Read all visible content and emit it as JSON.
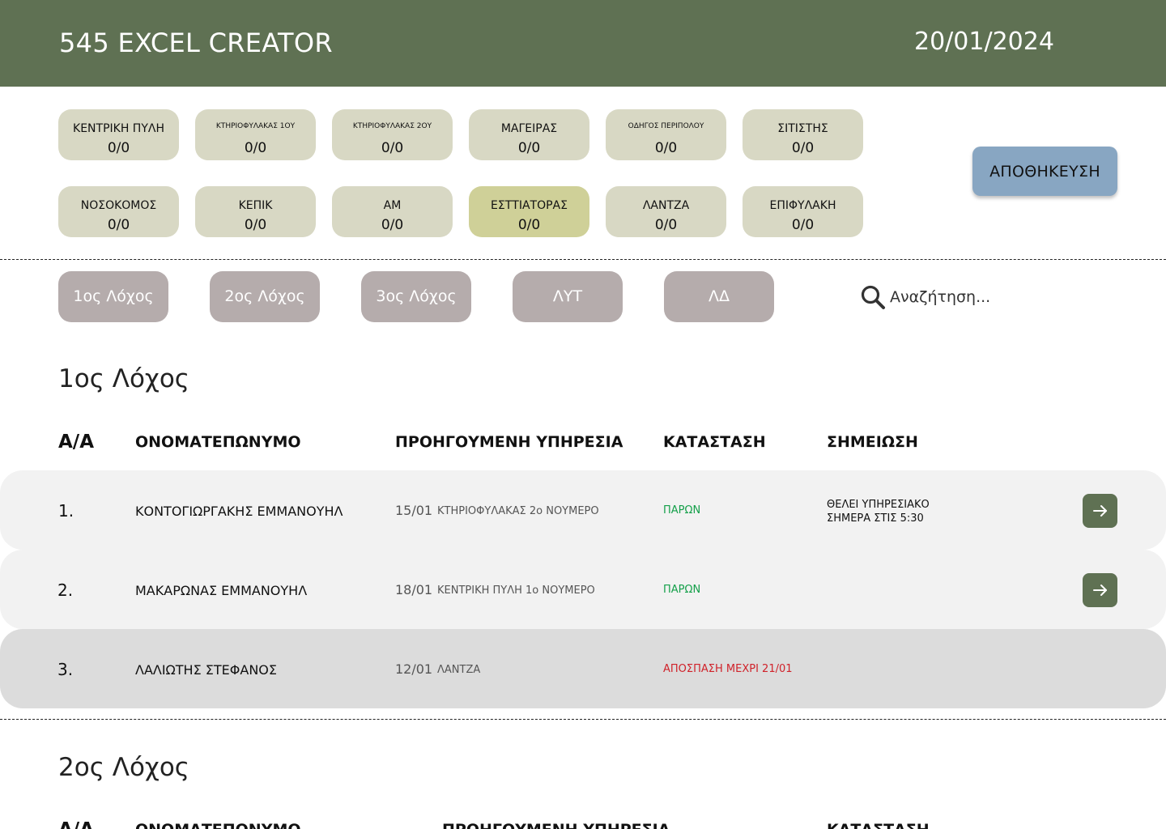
{
  "header": {
    "title": "545 EXCEL CREATOR",
    "date": "20/01/2024"
  },
  "posts": [
    {
      "name": "ΚΕΝΤΡΙΚΗ ΠΥΛΗ",
      "count": "0/0"
    },
    {
      "name": "ΚΤΗΡΙΟΦΥΛΑΚΑΣ 1ΟΥ",
      "count": "0/0"
    },
    {
      "name": "ΚΤΗΡΙΟΦΥΛΑΚΑΣ 2ΟΥ",
      "count": "0/0"
    },
    {
      "name": "ΜΑΓΕΙΡΑΣ",
      "count": "0/0"
    },
    {
      "name": "ΟΔΗΓΟΣ ΠΕΡΙΠΟΛΟΥ",
      "count": "0/0"
    },
    {
      "name": "ΣΙΤΙΣΤΗΣ",
      "count": "0/0"
    },
    {
      "name": "ΝΟΣΟΚΟΜΟΣ",
      "count": "0/0"
    },
    {
      "name": "ΚΕΠΙΚ",
      "count": "0/0"
    },
    {
      "name": "ΑΜ",
      "count": "0/0"
    },
    {
      "name": "ΕΣΤΤΙΑΤΟΡΑΣ",
      "count": "0/0"
    },
    {
      "name": "ΛΑΝΤΖΑ",
      "count": "0/0"
    },
    {
      "name": "ΕΠΙΦΥΛΑΚΗ",
      "count": "0/0"
    }
  ],
  "save_label": "ΑΠΟΘΗΚΕΥΣΗ",
  "filters": [
    "1ος Λόχος",
    "2ος Λόχος",
    "3ος Λόχος",
    "ΛΥΤ",
    "ΛΔ"
  ],
  "search": {
    "placeholder": "Αναζήτηση..."
  },
  "columns": {
    "aa": "Α/Α",
    "fullname": "ΟΝΟΜΑΤΕΠΩΝΥΜΟ",
    "previous": "ΠΡΟΗΓΟΥΜΕΝΗ ΥΠΗΡΕΣΙΑ",
    "status": "ΚΑΤΑΣΤΑΣΗ",
    "note": "ΣΗΜΕΙΩΣΗ"
  },
  "sections": [
    {
      "title": "1ος Λόχος",
      "rows": [
        {
          "num": "1.",
          "name": "ΚΟΝΤΟΓΙΩΡΓΑΚΗΣ ΕΜΜΑΝΟΥΗΛ",
          "date": "15/01",
          "duty": "ΚΤΗΡΙΟΦΥΛΑΚΑΣ 2ο ΝΟΥΜΕΡΟ",
          "status": "ΠΑΡΩΝ",
          "note1": "ΘΕΛΕΙ ΥΠΗΡΕΣΙΑΚΟ",
          "note2": "ΣΗΜΕΡΑ ΣΤΙΣ 5:30"
        },
        {
          "num": "2.",
          "name": "ΜΑΚΑΡΩΝΑΣ ΕΜΜΑΝΟΥΗΛ",
          "date": "18/01",
          "duty": "ΚΕΝΤΡΙΚΗ ΠΥΛΗ  1ο ΝΟΥΜΕΡΟ",
          "status": "ΠΑΡΩΝ",
          "note1": "",
          "note2": ""
        },
        {
          "num": "3.",
          "name": "ΛΑΛΙΩΤΗΣ ΣΤΕΦΑΝΟΣ",
          "date": "12/01",
          "duty": "ΛΑΝΤΖΑ",
          "status": "ΑΠΟΣΠΑΣΗ ΜΕΧΡΙ 21/01",
          "note1": "",
          "note2": ""
        }
      ]
    },
    {
      "title": "2ος Λόχος",
      "rows": []
    }
  ],
  "colors": {
    "header": "#5f7153",
    "post": "#d8d8c4",
    "post_highlight": "#cfd098",
    "save": "#88a6c2",
    "filter": "#b5acac",
    "present": "#15a04a",
    "away": "#d0222a"
  },
  "icons": {
    "search": "search-icon",
    "go": "arrow-right-icon"
  }
}
